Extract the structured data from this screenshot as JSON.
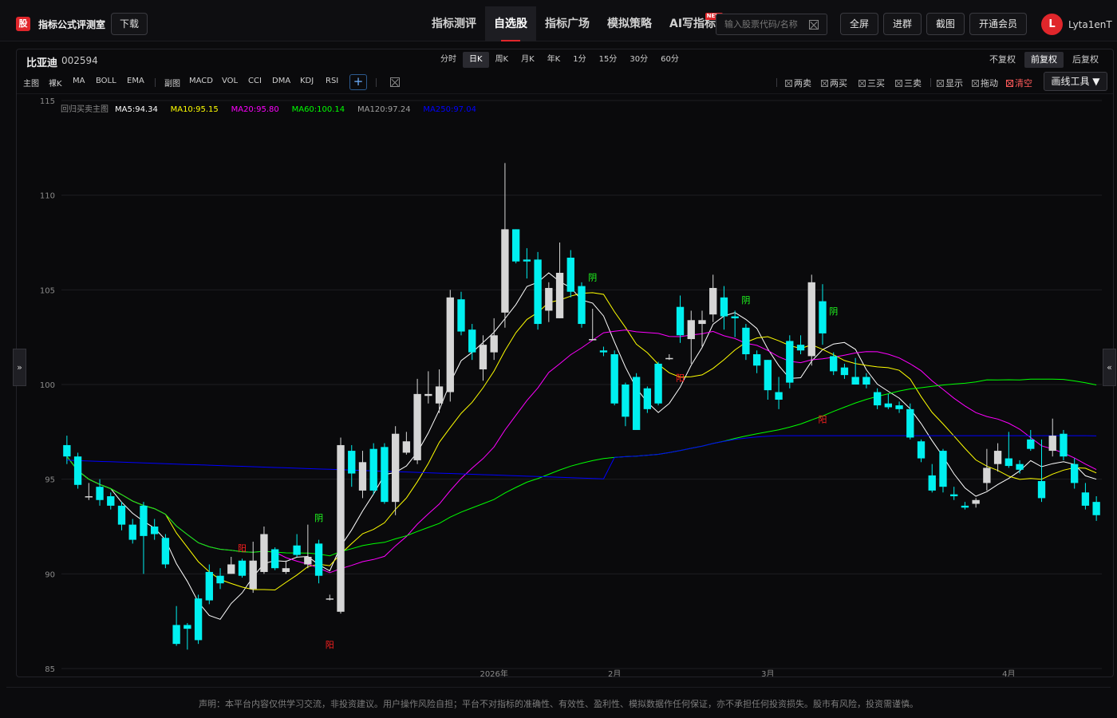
{
  "header": {
    "logo_text": "股",
    "brand": "指标公式评测室",
    "download": "下载",
    "nav": [
      {
        "label": "指标测评"
      },
      {
        "label": "自选股",
        "active": true
      },
      {
        "label": "指标广场"
      },
      {
        "label": "模拟策略"
      },
      {
        "label": "AI写指标",
        "badge": "NEW"
      }
    ],
    "search_placeholder": "输入股票代码/名称",
    "buttons": [
      "全屏",
      "进群",
      "截图",
      "开通会员"
    ],
    "avatar_letter": "L",
    "username": "Lyta1enT"
  },
  "stock": {
    "name": "比亚迪",
    "code": "002594"
  },
  "periods": [
    "分时",
    "日K",
    "周K",
    "月K",
    "年K",
    "1分",
    "15分",
    "30分",
    "60分"
  ],
  "active_period": "日K",
  "adjust": [
    "不复权",
    "前复权",
    "后复权"
  ],
  "active_adjust": "前复权",
  "main_indicators_label": "主图",
  "main_indicators": [
    "裸K",
    "MA",
    "BOLL",
    "EMA"
  ],
  "sub_indicators_label": "副图",
  "sub_indicators": [
    "MACD",
    "VOL",
    "CCI",
    "DMA",
    "KDJ",
    "RSI"
  ],
  "plus_label": "+",
  "signal_toggles": [
    "两卖",
    "两买",
    "三买",
    "三卖",
    "显示",
    "拖动"
  ],
  "clear_label": "清空",
  "draw_tools": "画线工具 ▼",
  "side_left": "»",
  "side_right": "«",
  "footer": "声明：本平台内容仅供学习交流，非投资建议。用户操作风险自担；平台不对指标的准确性、有效性、盈利性、模拟数据作任何保证，亦不承担任何投资损失。股市有风险，投资需谨慎。",
  "chart_data": {
    "type": "candlestick",
    "title": "回归买卖主图",
    "ylim": [
      85,
      115
    ],
    "y_ticks": [
      85,
      90,
      95,
      100,
      105,
      110,
      115
    ],
    "x_labels": [
      {
        "index": 39,
        "label": "2026年"
      },
      {
        "index": 50,
        "label": "2月"
      },
      {
        "index": 64,
        "label": "3月"
      },
      {
        "index": 86,
        "label": "4月"
      }
    ],
    "grid": true,
    "ma_legend": [
      {
        "name": "MA5",
        "value": "94.34",
        "color": "#ffffff"
      },
      {
        "name": "MA10",
        "value": "95.15",
        "color": "#ffff00"
      },
      {
        "name": "MA20",
        "value": "95.80",
        "color": "#ff00ff"
      },
      {
        "name": "MA60",
        "value": "100.14",
        "color": "#00ff00"
      },
      {
        "name": "MA120",
        "value": "97.24",
        "color": "#a0a0a0"
      },
      {
        "name": "MA250",
        "value": "97.04",
        "color": "#0000ff"
      }
    ],
    "up_color": "#d6d6d6",
    "down_color": "#00f0f0",
    "candles": [
      [
        96.8,
        96.2,
        97.3,
        95.8
      ],
      [
        96.2,
        94.7,
        96.4,
        94.5
      ],
      [
        94.1,
        94.1,
        94.8,
        93.9
      ],
      [
        94.6,
        93.9,
        95.0,
        93.6
      ],
      [
        94.1,
        93.6,
        94.3,
        93.4
      ],
      [
        93.6,
        92.6,
        93.8,
        92.3
      ],
      [
        92.6,
        91.8,
        92.9,
        91.6
      ],
      [
        93.6,
        92.0,
        93.8,
        90.0
      ],
      [
        92.5,
        92.1,
        92.9,
        91.8
      ],
      [
        91.9,
        90.5,
        92.1,
        90.3
      ],
      [
        87.3,
        86.3,
        88.3,
        86.2
      ],
      [
        87.3,
        87.1,
        87.4,
        86.0
      ],
      [
        88.7,
        86.5,
        88.9,
        86.3
      ],
      [
        90.1,
        88.6,
        90.5,
        88.4
      ],
      [
        89.9,
        89.5,
        90.3,
        89.2
      ],
      [
        90.0,
        90.5,
        90.9,
        90.0
      ],
      [
        90.7,
        89.9,
        90.8,
        89.8
      ],
      [
        89.2,
        90.7,
        91.7,
        89.0
      ],
      [
        90.1,
        92.1,
        92.5,
        90.0
      ],
      [
        91.3,
        90.3,
        91.4,
        90.2
      ],
      [
        90.1,
        90.3,
        90.7,
        90.0
      ],
      [
        91.5,
        91.0,
        92.1,
        90.9
      ],
      [
        90.5,
        90.9,
        92.6,
        90.3
      ],
      [
        91.6,
        89.9,
        91.8,
        89.5
      ],
      [
        88.7,
        88.7,
        88.9,
        88.6
      ],
      [
        88.0,
        96.8,
        97.2,
        87.9
      ],
      [
        96.5,
        95.3,
        96.8,
        94.6
      ],
      [
        94.4,
        95.9,
        96.5,
        94.0
      ],
      [
        96.6,
        94.4,
        96.9,
        94.2
      ],
      [
        96.7,
        93.8,
        96.9,
        93.7
      ],
      [
        93.8,
        97.4,
        97.8,
        93.1
      ],
      [
        96.4,
        97.0,
        97.5,
        96.3
      ],
      [
        96.0,
        99.5,
        100.3,
        95.8
      ],
      [
        99.4,
        99.5,
        100.7,
        99.0
      ],
      [
        99.0,
        99.9,
        100.8,
        98.5
      ],
      [
        99.6,
        104.6,
        105.0,
        99.1
      ],
      [
        104.5,
        102.8,
        104.9,
        102.6
      ],
      [
        102.9,
        101.7,
        103.2,
        101.3
      ],
      [
        100.8,
        102.1,
        102.6,
        100.2
      ],
      [
        101.7,
        102.6,
        103.5,
        101.3
      ],
      [
        103.8,
        108.2,
        111.7,
        103.0
      ],
      [
        108.2,
        106.5,
        108.2,
        106.4
      ],
      [
        106.6,
        106.5,
        107.2,
        105.6
      ],
      [
        106.6,
        103.2,
        107.0,
        102.9
      ],
      [
        103.9,
        105.1,
        105.4,
        103.3
      ],
      [
        103.5,
        105.9,
        107.5,
        103.5
      ],
      [
        106.7,
        104.9,
        107.1,
        104.6
      ],
      [
        105.2,
        103.2,
        105.4,
        103.0
      ],
      [
        102.4,
        102.4,
        104.0,
        102.4
      ],
      [
        101.8,
        101.7,
        102.0,
        101.5
      ],
      [
        101.6,
        99.0,
        101.8,
        98.9
      ],
      [
        100.0,
        98.3,
        100.1,
        97.8
      ],
      [
        100.4,
        97.6,
        100.6,
        97.7
      ],
      [
        99.8,
        98.7,
        99.9,
        98.5
      ],
      [
        101.1,
        99.0,
        101.2,
        98.9
      ],
      [
        101.4,
        101.4,
        101.6,
        101.3
      ],
      [
        104.1,
        102.6,
        104.7,
        102.2
      ],
      [
        102.4,
        103.4,
        103.9,
        101.1
      ],
      [
        103.2,
        103.4,
        103.9,
        102.0
      ],
      [
        103.7,
        105.1,
        105.8,
        103.3
      ],
      [
        104.6,
        103.6,
        105.2,
        102.9
      ],
      [
        103.6,
        103.5,
        103.9,
        102.5
      ],
      [
        103.0,
        101.6,
        103.2,
        101.3
      ],
      [
        101.6,
        101.0,
        101.8,
        100.6
      ],
      [
        101.3,
        99.7,
        101.3,
        99.2
      ],
      [
        99.6,
        99.2,
        100.4,
        98.7
      ],
      [
        102.3,
        100.1,
        102.6,
        99.8
      ],
      [
        102.1,
        101.8,
        102.6,
        101.6
      ],
      [
        101.5,
        105.4,
        105.8,
        101.0
      ],
      [
        104.4,
        102.7,
        105.3,
        102.1
      ],
      [
        101.5,
        100.7,
        101.7,
        100.5
      ],
      [
        100.9,
        100.5,
        101.1,
        100.3
      ],
      [
        100.4,
        100.0,
        101.4,
        100.0
      ],
      [
        100.4,
        100.0,
        100.6,
        99.8
      ],
      [
        99.6,
        98.9,
        99.8,
        98.7
      ],
      [
        99.0,
        98.8,
        99.5,
        98.7
      ],
      [
        98.9,
        98.7,
        99.1,
        98.5
      ],
      [
        98.7,
        97.2,
        99.0,
        97.1
      ],
      [
        97.0,
        96.1,
        97.1,
        95.9
      ],
      [
        95.2,
        94.4,
        95.8,
        94.3
      ],
      [
        96.5,
        94.6,
        96.6,
        94.3
      ],
      [
        94.2,
        94.1,
        94.6,
        93.9
      ],
      [
        93.6,
        93.5,
        93.8,
        93.4
      ],
      [
        93.7,
        93.9,
        94.0,
        93.5
      ],
      [
        94.8,
        95.6,
        96.6,
        94.4
      ],
      [
        95.8,
        96.5,
        96.9,
        95.4
      ],
      [
        96.1,
        95.7,
        97.5,
        95.6
      ],
      [
        95.8,
        95.5,
        96.0,
        95.3
      ],
      [
        97.1,
        96.6,
        97.6,
        96.5
      ],
      [
        94.9,
        94.0,
        97.1,
        93.8
      ],
      [
        96.5,
        97.3,
        98.2,
        96.2
      ],
      [
        97.4,
        96.2,
        97.6,
        96.0
      ],
      [
        95.8,
        94.8,
        96.1,
        94.5
      ],
      [
        94.3,
        93.6,
        94.8,
        93.4
      ],
      [
        93.8,
        93.1,
        94.1,
        92.8
      ]
    ],
    "annotations": [
      {
        "index": 16,
        "price": 91.2,
        "label": "阳",
        "color": "#ff2020"
      },
      {
        "index": 23,
        "price": 92.8,
        "label": "阴",
        "color": "#20ff20"
      },
      {
        "index": 24,
        "price": 86.1,
        "label": "阳",
        "color": "#ff2020"
      },
      {
        "index": 48,
        "price": 105.5,
        "label": "阴",
        "color": "#20ff20"
      },
      {
        "index": 56,
        "price": 100.2,
        "label": "阳",
        "color": "#ff2020"
      },
      {
        "index": 62,
        "price": 104.3,
        "label": "阴",
        "color": "#20ff20"
      },
      {
        "index": 69,
        "price": 98.0,
        "label": "阳",
        "color": "#ff2020"
      },
      {
        "index": 70,
        "price": 103.7,
        "label": "阴",
        "color": "#20ff20"
      }
    ]
  }
}
